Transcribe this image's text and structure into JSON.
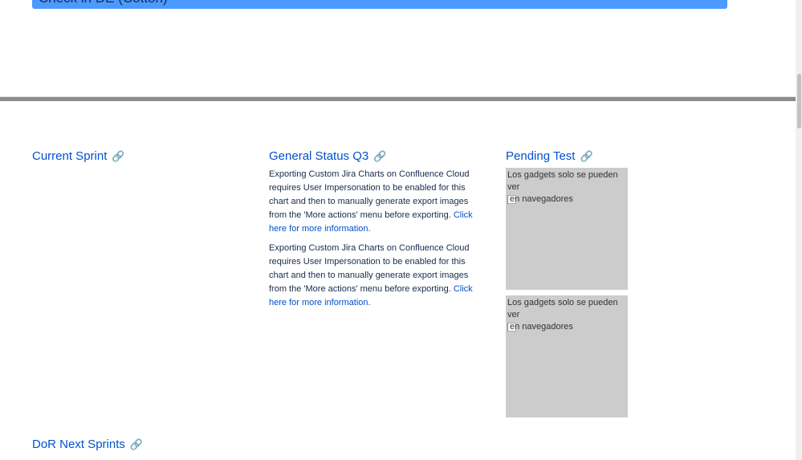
{
  "banner": {
    "label": "Check in DE (Cotton)"
  },
  "sections": {
    "current_sprint": "Current Sprint",
    "general_status": "General Status Q3",
    "pending_test": "Pending Test",
    "dor_next": "DoR Next Sprints"
  },
  "messages": [
    {
      "text": "Exporting Custom Jira Charts on Confluence Cloud requires User Impersonation to be enabled for this chart and then to manually generate export images from the 'More actions' menu before exporting. ",
      "link": "Click here for more information."
    },
    {
      "text": "Exporting Custom Jira Charts on Confluence Cloud requires User Impersonation to be enabled for this chart and then to manually generate export images from the 'More actions' menu before exporting. ",
      "link": "Click here for more information."
    }
  ],
  "gadgets": [
    {
      "line1": "Los gadgets solo se pueden ver",
      "line2": "en navegadores"
    },
    {
      "line1": "Los gadgets solo se pueden ver",
      "line2": "en navegadores"
    }
  ],
  "link_icon": "🔗"
}
